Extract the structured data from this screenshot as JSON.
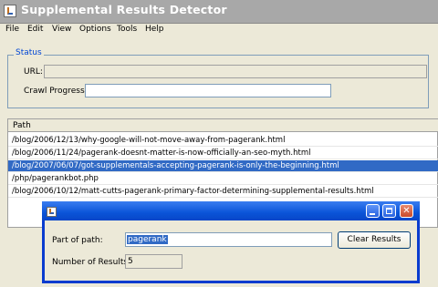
{
  "window": {
    "title": "Supplemental Results Detector"
  },
  "menu": [
    "File",
    "Edit",
    "View",
    "Options",
    "Tools",
    "Help"
  ],
  "status": {
    "group_title": "Status",
    "url_label": "URL:",
    "url_value": "",
    "crawl_progress_label": "Crawl Progress:",
    "crawl_progress_value": ""
  },
  "table": {
    "header": "Path",
    "rows": [
      "/blog/2006/12/13/why-google-will-not-move-away-from-pagerank.html",
      "/blog/2006/11/24/pagerank-doesnt-matter-is-now-officially-an-seo-myth.html",
      "/blog/2007/06/07/got-supplementals-accepting-pagerank-is-only-the-beginning.html",
      "/php/pagerankbot.php",
      "/blog/2006/10/12/matt-cutts-pagerank-primary-factor-determining-supplemental-results.html"
    ],
    "selected_row": 2
  },
  "dialog": {
    "part_label": "Part of path:",
    "part_value": "pagerank",
    "clear_button": "Clear Results",
    "count_label": "Number of Results:",
    "count_value": "5"
  },
  "colors": {
    "selection": "#316ac5",
    "dialog_border": "#0a3ccf",
    "group_title": "#0046d5"
  }
}
